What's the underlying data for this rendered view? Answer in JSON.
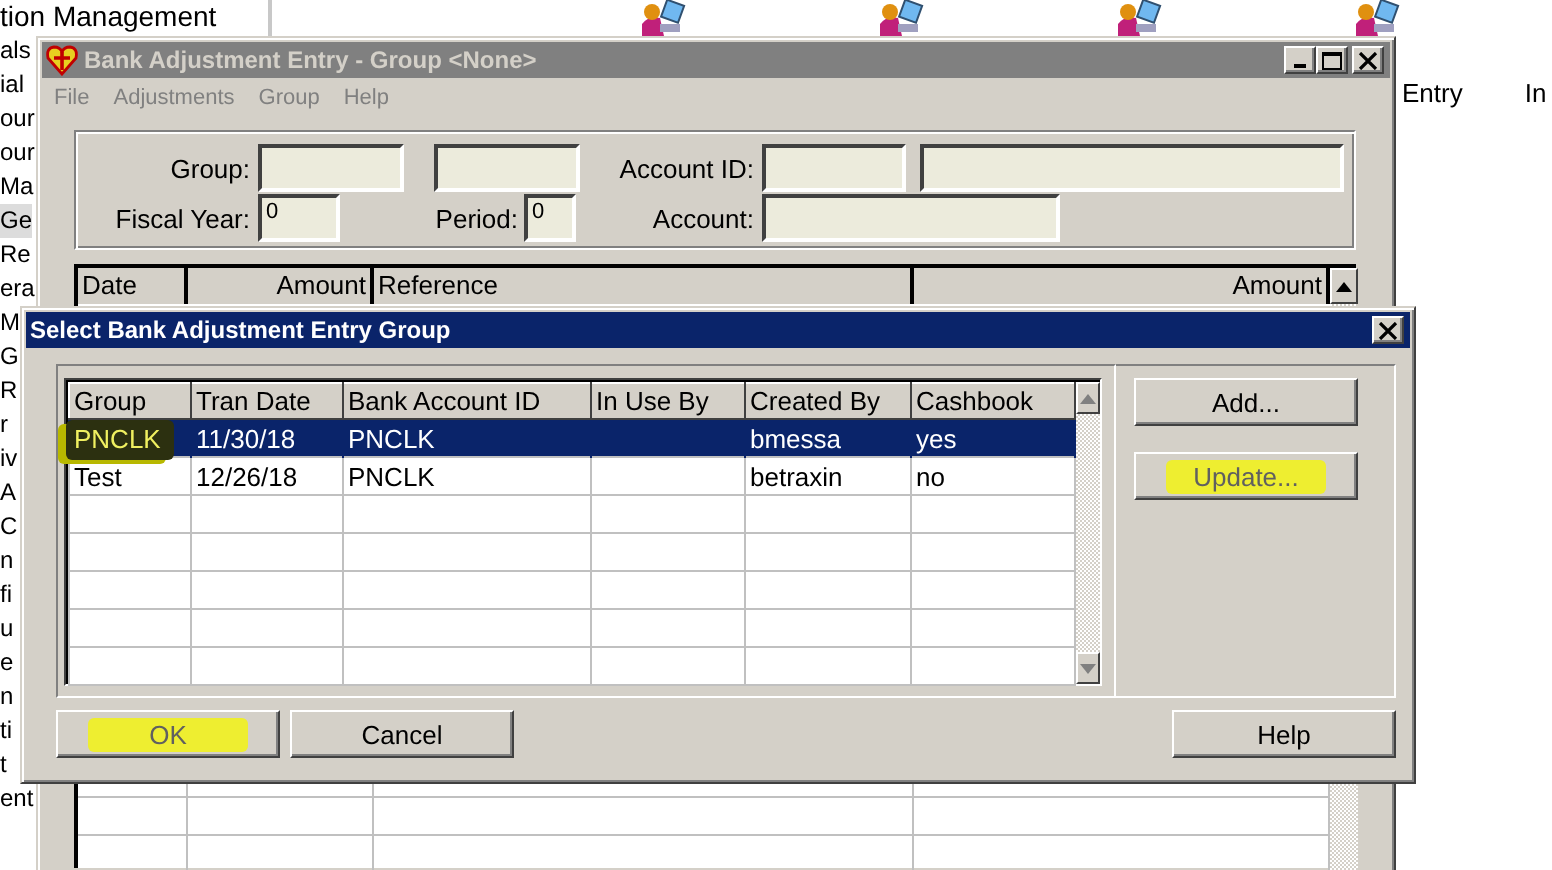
{
  "background_list": {
    "items": [
      {
        "label": "tion Management",
        "selected": false
      },
      {
        "label": "als",
        "selected": false
      },
      {
        "label": "ial",
        "selected": false
      },
      {
        "label": "our",
        "selected": false
      },
      {
        "label": "our",
        "selected": false
      },
      {
        "label": "Ma",
        "selected": false
      },
      {
        "label": "Ge",
        "selected": true
      },
      {
        "label": "Re",
        "selected": false
      },
      {
        "label": "era",
        "selected": false
      },
      {
        "label": "M",
        "selected": false
      },
      {
        "label": "G",
        "selected": false
      },
      {
        "label": "R",
        "selected": false
      },
      {
        "label": "r",
        "selected": false
      },
      {
        "label": "iv",
        "selected": false
      },
      {
        "label": "A",
        "selected": false
      },
      {
        "label": "C",
        "selected": false
      },
      {
        "label": "n",
        "selected": false
      },
      {
        "label": "fi",
        "selected": false
      },
      {
        "label": "u",
        "selected": false
      },
      {
        "label": "e",
        "selected": false
      },
      {
        "label": "n",
        "selected": false
      },
      {
        "label": "ti",
        "selected": false
      },
      {
        "label": "t",
        "selected": false
      },
      {
        "label": "ent",
        "selected": false
      }
    ]
  },
  "background_labels": [
    "Entry",
    "In"
  ],
  "bank_window": {
    "title": "Bank Adjustment Entry - Group <None>",
    "active": false,
    "menu": [
      {
        "label": "File",
        "disabled": true
      },
      {
        "label": "Adjustments",
        "disabled": true
      },
      {
        "label": "Group",
        "disabled": true
      },
      {
        "label": "Help",
        "disabled": true
      }
    ],
    "fields": [
      {
        "label": "Group:"
      },
      {
        "label": "Fiscal Year:",
        "value": "0"
      },
      {
        "label": "Period:",
        "value": "0"
      },
      {
        "label": "Account ID:"
      },
      {
        "label": "Account:"
      }
    ],
    "columns": [
      {
        "label": "Date",
        "kind": "text"
      },
      {
        "label": "Amount",
        "kind": "amount"
      },
      {
        "label": "Reference",
        "kind": "text"
      },
      {
        "label": "Amount",
        "kind": "amount"
      }
    ]
  },
  "dialog": {
    "title": "Select Bank Adjustment Entry Group",
    "active": true,
    "columns": [
      "Group",
      "Tran Date",
      "Bank Account ID",
      "In Use By",
      "Created By",
      "Cashbook"
    ],
    "rows": [
      {
        "cells": [
          "PNCLK",
          "11/30/18",
          "PNCLK",
          "",
          "bmessa",
          "yes"
        ],
        "selected": true,
        "highlighted": true
      },
      {
        "cells": [
          "Test",
          "12/26/18",
          "PNCLK",
          "",
          "betraxin",
          "no"
        ],
        "selected": false,
        "highlighted": false
      }
    ],
    "side_buttons": [
      {
        "label": "Add...",
        "disabled": false,
        "highlighted": false
      },
      {
        "label": "Update...",
        "disabled": true,
        "highlighted": true
      }
    ],
    "bottom_buttons": [
      {
        "label": "OK",
        "disabled": true,
        "highlighted": true
      },
      {
        "label": "Cancel",
        "disabled": false,
        "highlighted": false
      },
      {
        "label": "Help",
        "disabled": false,
        "highlighted": false
      }
    ]
  }
}
